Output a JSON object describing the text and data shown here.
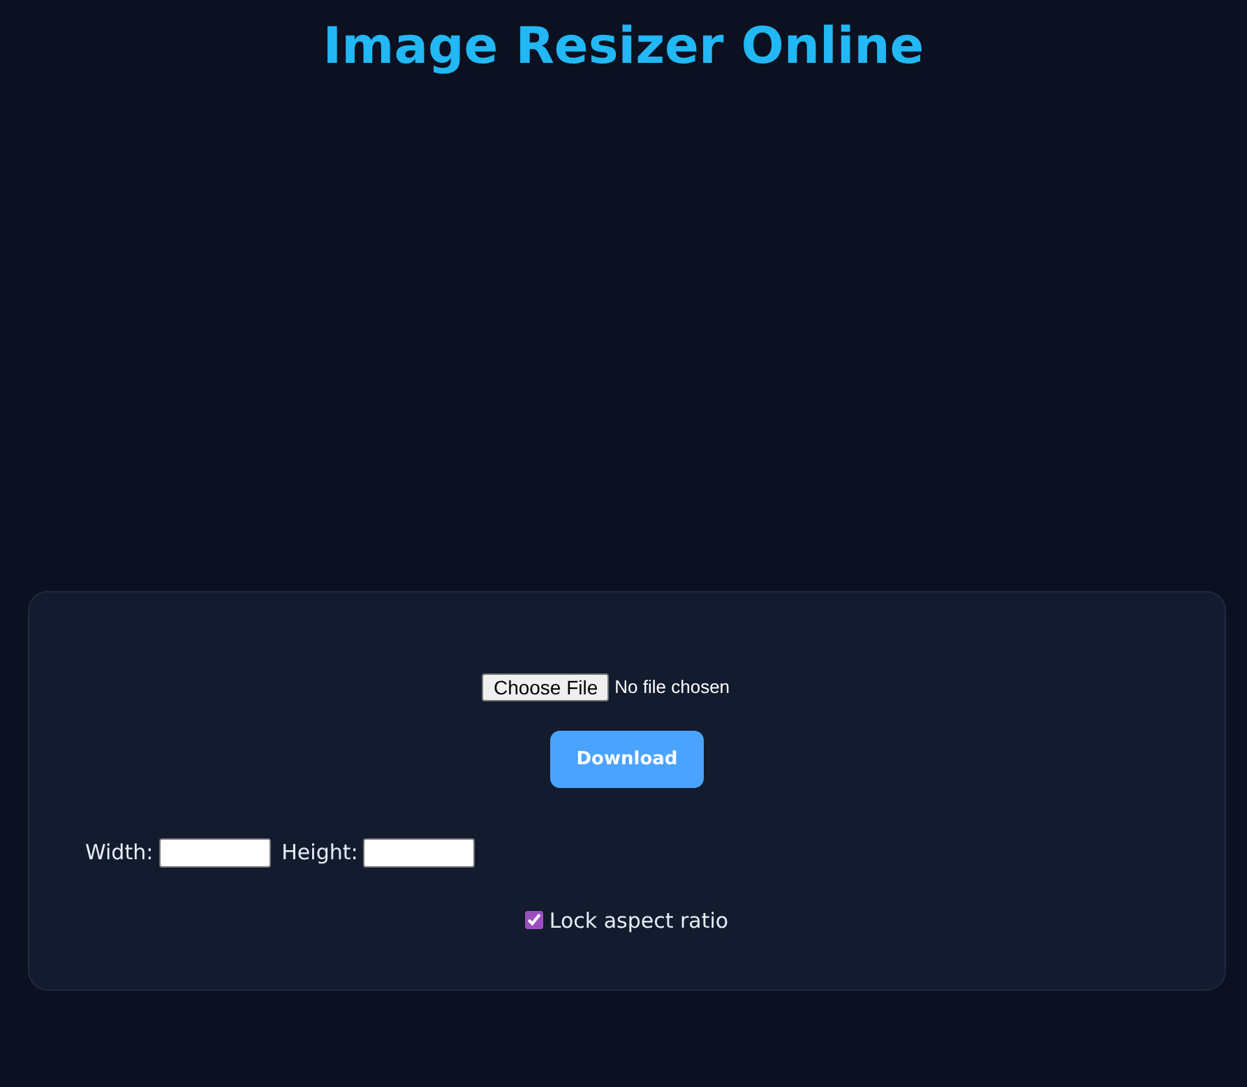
{
  "title": "Image Resizer Online",
  "file_input": {
    "button": "Choose File",
    "status": "No file chosen"
  },
  "download_button": "Download",
  "width_field": {
    "label": "Width:"
  },
  "height_field": {
    "label": "Height:"
  },
  "lock_aspect": {
    "label": "Lock aspect ratio",
    "checked": true
  }
}
